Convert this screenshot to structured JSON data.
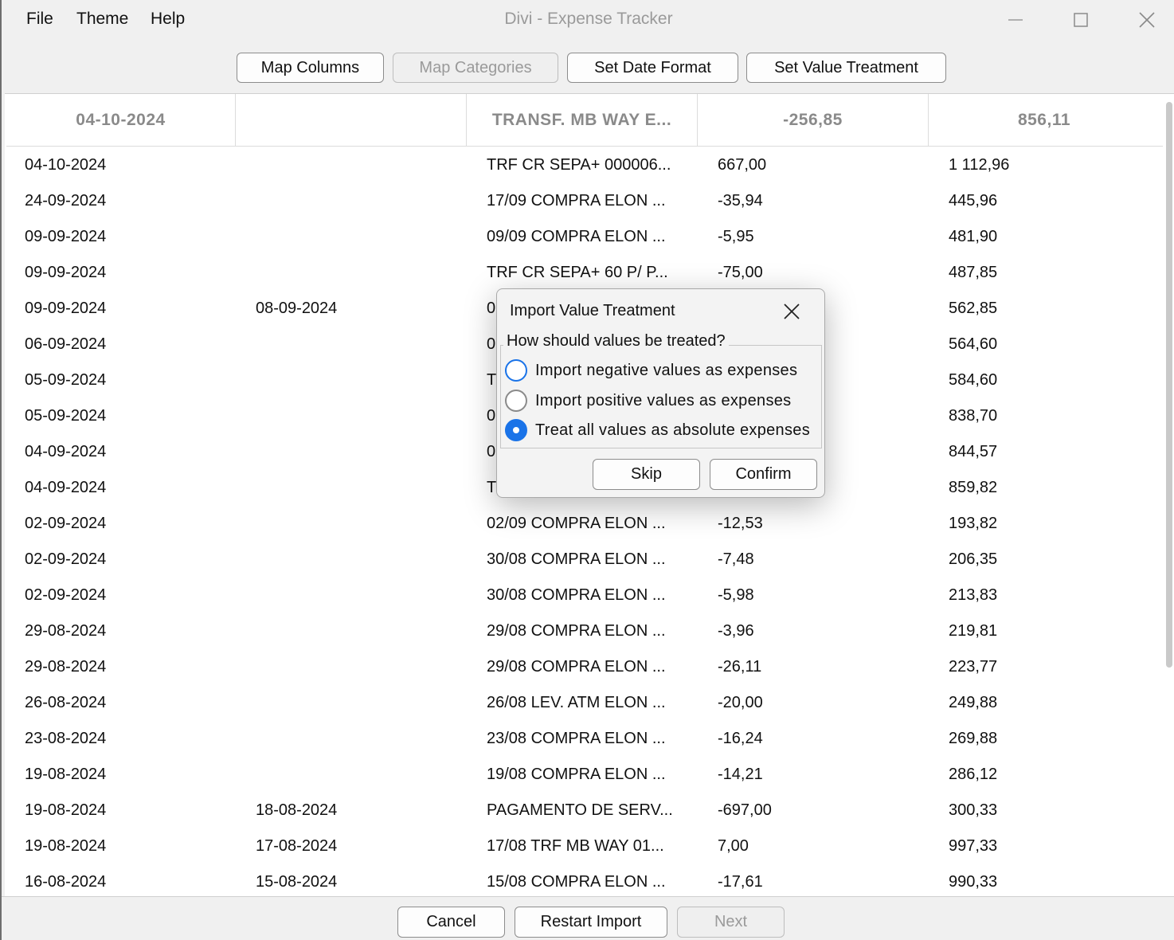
{
  "menu": {
    "file": "File",
    "theme": "Theme",
    "help": "Help"
  },
  "window": {
    "title": "Divi - Expense Tracker"
  },
  "toolbar": {
    "map_columns": "Map Columns",
    "map_categories": "Map Categories",
    "set_date_format": "Set Date Format",
    "set_value_treatment": "Set Value Treatment"
  },
  "table": {
    "headers": [
      "04-10-2024",
      "",
      "TRANSF. MB WAY E...",
      "-256,85",
      "856,11"
    ],
    "rows": [
      [
        "04-10-2024",
        "",
        "TRF CR SEPA+ 000006...",
        "667,00",
        "1 112,96"
      ],
      [
        "24-09-2024",
        "",
        "17/09 COMPRA ELON ...",
        "-35,94",
        "445,96"
      ],
      [
        "09-09-2024",
        "",
        "09/09 COMPRA ELON ...",
        "-5,95",
        "481,90"
      ],
      [
        "09-09-2024",
        "",
        "TRF CR SEPA+ 60 P/ P...",
        "-75,00",
        "487,85"
      ],
      [
        "09-09-2024",
        "08-09-2024",
        "0",
        "",
        "562,85"
      ],
      [
        "06-09-2024",
        "",
        "0",
        "",
        "564,60"
      ],
      [
        "05-09-2024",
        "",
        "T",
        "",
        "584,60"
      ],
      [
        "05-09-2024",
        "",
        "0",
        "",
        "838,70"
      ],
      [
        "04-09-2024",
        "",
        "0",
        "",
        "844,57"
      ],
      [
        "04-09-2024",
        "",
        "T",
        "",
        "859,82"
      ],
      [
        "02-09-2024",
        "",
        "02/09 COMPRA ELON ...",
        "-12,53",
        "193,82"
      ],
      [
        "02-09-2024",
        "",
        "30/08 COMPRA ELON ...",
        "-7,48",
        "206,35"
      ],
      [
        "02-09-2024",
        "",
        "30/08 COMPRA ELON ...",
        "-5,98",
        "213,83"
      ],
      [
        "29-08-2024",
        "",
        "29/08 COMPRA ELON ...",
        "-3,96",
        "219,81"
      ],
      [
        "29-08-2024",
        "",
        "29/08 COMPRA ELON ...",
        "-26,11",
        "223,77"
      ],
      [
        "26-08-2024",
        "",
        "26/08 LEV. ATM ELON ...",
        "-20,00",
        "249,88"
      ],
      [
        "23-08-2024",
        "",
        "23/08 COMPRA ELON ...",
        "-16,24",
        "269,88"
      ],
      [
        "19-08-2024",
        "",
        "19/08 COMPRA ELON ...",
        "-14,21",
        "286,12"
      ],
      [
        "19-08-2024",
        "18-08-2024",
        "PAGAMENTO DE SERV...",
        "-697,00",
        "300,33"
      ],
      [
        "19-08-2024",
        "17-08-2024",
        "17/08 TRF MB WAY 01...",
        "7,00",
        "997,33"
      ],
      [
        "16-08-2024",
        "15-08-2024",
        "15/08 COMPRA ELON ...",
        "-17,61",
        "990,33"
      ]
    ]
  },
  "bottom": {
    "cancel": "Cancel",
    "restart": "Restart Import",
    "next": "Next"
  },
  "dialog": {
    "title": "Import Value Treatment",
    "question": "How should values be treated?",
    "options": [
      "Import negative values as expenses",
      "Import positive values as expenses",
      "Treat all values as absolute expenses"
    ],
    "selected_index": 2,
    "skip": "Skip",
    "confirm": "Confirm"
  },
  "colors": {
    "accent": "#1a73e8",
    "disabled_text": "#9a9a9a",
    "header_text": "#8a8a8a"
  }
}
